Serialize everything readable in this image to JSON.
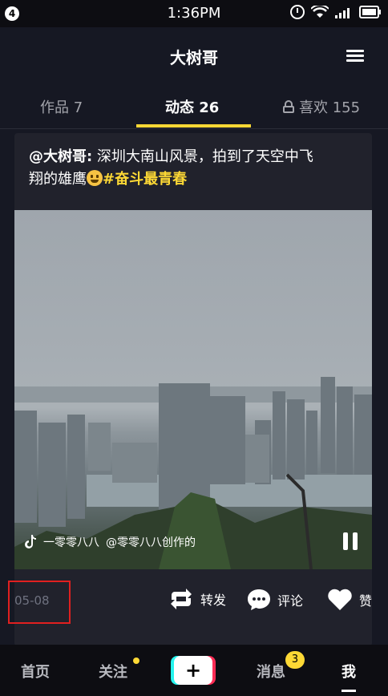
{
  "status_bar": {
    "badge": "4",
    "time": "1:36PM"
  },
  "header": {
    "title": "大树哥"
  },
  "tabs": {
    "works": "作品 7",
    "dynamics": "动态 26",
    "likes": "喜欢 155"
  },
  "post": {
    "author": "@大树哥:",
    "text_line1": " 深圳大南山风景，拍到了天空中飞",
    "text_line2": "翔的雄鹰",
    "hashtag": "#奋斗最青春",
    "video_caption_music": "一零零八八",
    "video_caption_user": "@零零八八创作的",
    "date": "05-08",
    "actions": {
      "repost": "转发",
      "comment": "评论",
      "like": "赞"
    }
  },
  "bottom_nav": {
    "home": "首页",
    "follow": "关注",
    "plus": "+",
    "messages": "消息",
    "messages_badge": "3",
    "me": "我"
  },
  "colors": {
    "background": "#161823",
    "accent": "#fdd835",
    "highlight_box": "#e02020"
  }
}
